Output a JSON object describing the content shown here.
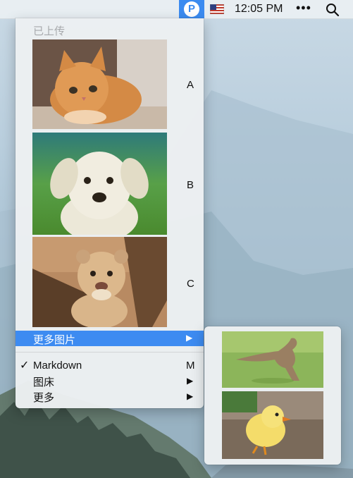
{
  "menubar": {
    "app_icon_letter": "P",
    "clock": "12:05 PM",
    "more_glyph": "•••",
    "icons": [
      "app-icon",
      "us-flag-icon",
      "more-icon",
      "search-icon"
    ]
  },
  "menu": {
    "header": "已上传",
    "images": [
      {
        "subject": "kitten",
        "key": "A"
      },
      {
        "subject": "puppy",
        "key": "B"
      },
      {
        "subject": "lion-cub",
        "key": "C"
      }
    ],
    "more_images": {
      "label": "更多图片",
      "arrow": "▶"
    },
    "items": [
      {
        "label": "Markdown",
        "checked": true,
        "check_glyph": "✓",
        "key": "M"
      },
      {
        "label": "图床",
        "arrow": "▶"
      },
      {
        "label": "更多",
        "arrow": "▶"
      }
    ]
  },
  "submenu": {
    "images": [
      {
        "subject": "kangaroo"
      },
      {
        "subject": "chick"
      }
    ]
  },
  "colors": {
    "highlight": "#3d8bf1",
    "menu_bg": "#eceff2",
    "app_icon_bg": "#3b8bf0"
  }
}
